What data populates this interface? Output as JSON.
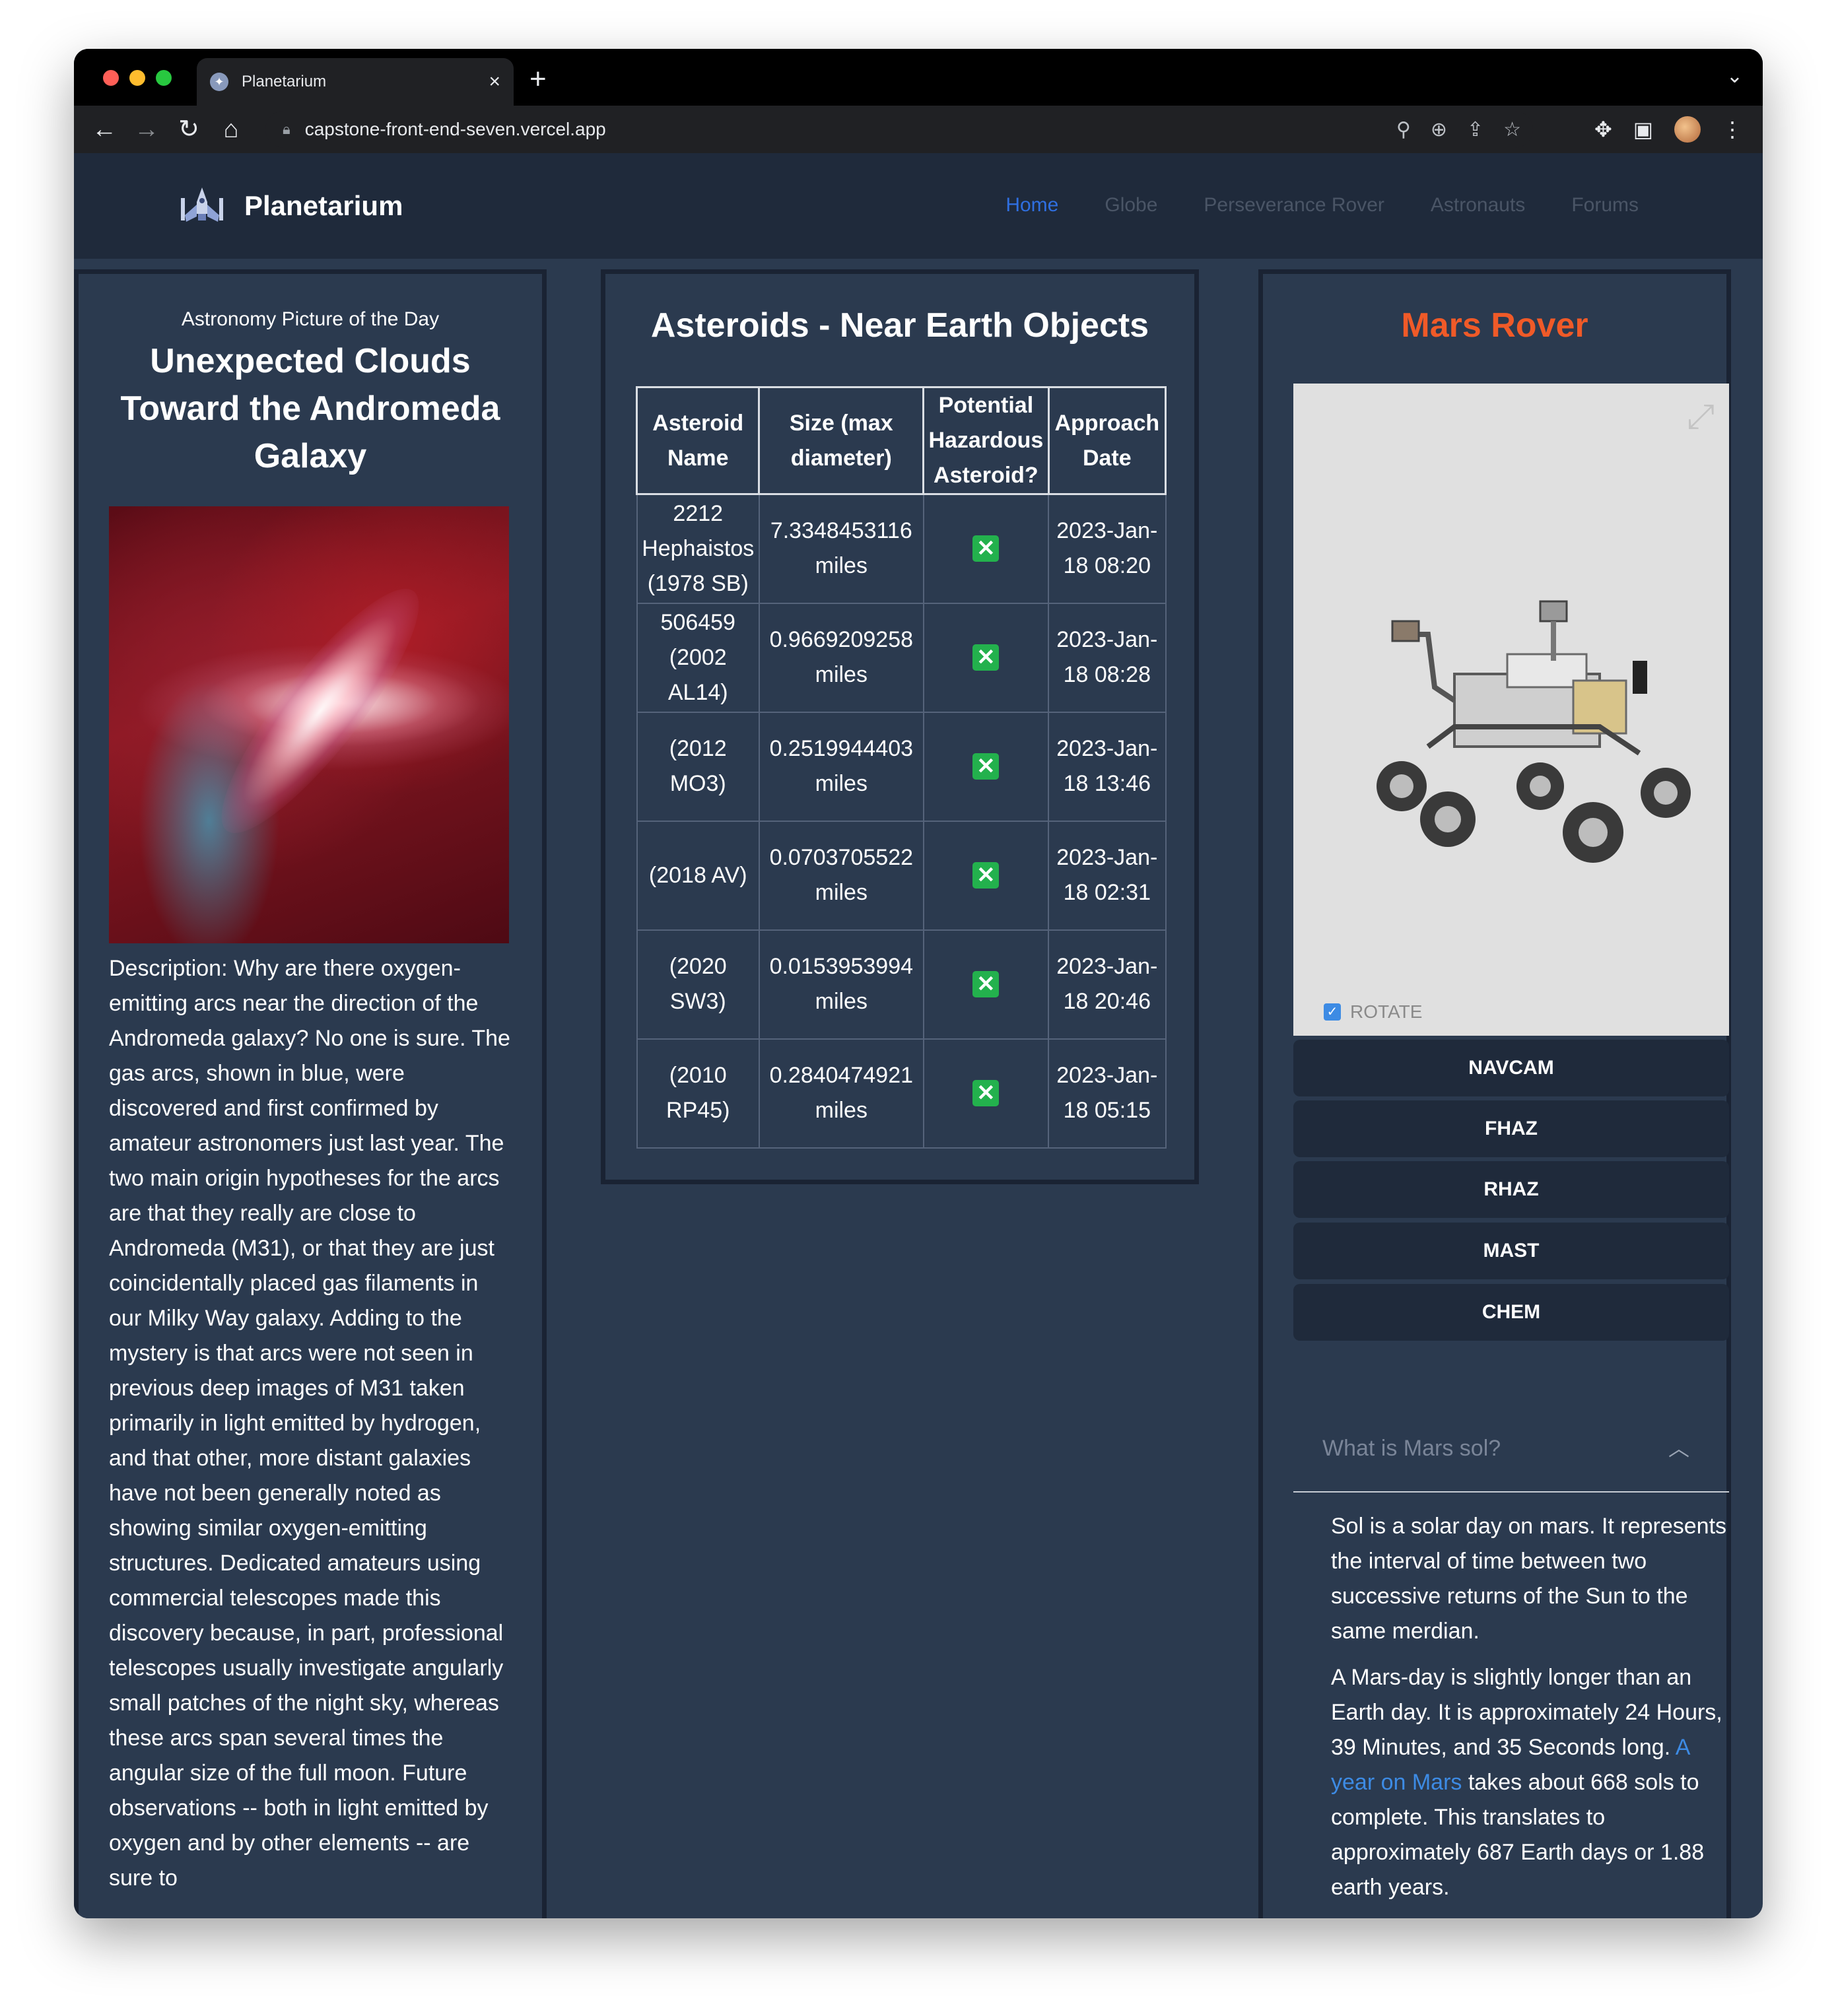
{
  "browser": {
    "tab_title": "Planetarium",
    "url": "capstone-front-end-seven.vercel.app",
    "traffic_lights": [
      "#ff5f57",
      "#febc2e",
      "#28c840"
    ]
  },
  "site": {
    "brand": "Planetarium",
    "nav": [
      "Home",
      "Globe",
      "Perseverance Rover",
      "Astronauts",
      "Forums"
    ],
    "active_nav": "Home"
  },
  "apod": {
    "kicker": "Astronomy Picture of the Day",
    "title": "Unexpected Clouds Toward the Andromeda Galaxy",
    "description": "Description: Why are there oxygen-emitting arcs near the direction of the Andromeda galaxy? No one is sure. The gas arcs, shown in blue, were discovered and first confirmed by amateur astronomers just last year. The two main origin hypotheses for the arcs are that they really are close to Andromeda (M31), or that they are just coincidentally placed gas filaments in our Milky Way galaxy. Adding to the mystery is that arcs were not seen in previous deep images of M31 taken primarily in light emitted by hydrogen, and that other, more distant galaxies have not been generally noted as showing similar oxygen-emitting structures. Dedicated amateurs using commercial telescopes made this discovery because, in part, professional telescopes usually investigate angularly small patches of the night sky, whereas these arcs span several times the angular size of the full moon. Future observations -- both in light emitted by oxygen and by other elements -- are sure to"
  },
  "neo": {
    "title": "Asteroids - Near Earth Objects",
    "headers": [
      "Asteroid Name",
      "Size (max diameter)",
      "Potential Hazardous Asteroid?",
      "Approach Date"
    ],
    "rows": [
      {
        "name": "2212 Hephaistos (1978 SB)",
        "size": "7.3348453116 miles",
        "hazard": "✕",
        "date": "2023-Jan-18 08:20"
      },
      {
        "name": "506459 (2002 AL14)",
        "size": "0.9669209258 miles",
        "hazard": "✕",
        "date": "2023-Jan-18 08:28"
      },
      {
        "name": "(2012 MO3)",
        "size": "0.2519944403 miles",
        "hazard": "✕",
        "date": "2023-Jan-18 13:46"
      },
      {
        "name": "(2018 AV)",
        "size": "0.0703705522 miles",
        "hazard": "✕",
        "date": "2023-Jan-18 02:31"
      },
      {
        "name": "(2020 SW3)",
        "size": "0.0153953994 miles",
        "hazard": "✕",
        "date": "2023-Jan-18 20:46"
      },
      {
        "name": "(2010 RP45)",
        "size": "0.2840474921 miles",
        "hazard": "✕",
        "date": "2023-Jan-18 05:15"
      }
    ]
  },
  "mars": {
    "title": "Mars Rover",
    "rotate_label": "ROTATE",
    "rotate_checked": true,
    "cameras": [
      "NAVCAM",
      "FHAZ",
      "RHAZ",
      "MAST",
      "CHEM"
    ],
    "accordion_title": "What is Mars sol?",
    "sol_p1": "Sol is a solar day on mars. It represents the interval of time between two successive returns of the Sun to the same merdian.",
    "sol_p2_before": "A Mars-day is slightly longer than an Earth day. It is approximately 24 Hours, 39 Minutes, and 35 Seconds long. ",
    "sol_link": "A year on Mars",
    "sol_p2_after": " takes about 668 sols to complete. This translates to approximately 687 Earth days or 1.88 earth years."
  }
}
